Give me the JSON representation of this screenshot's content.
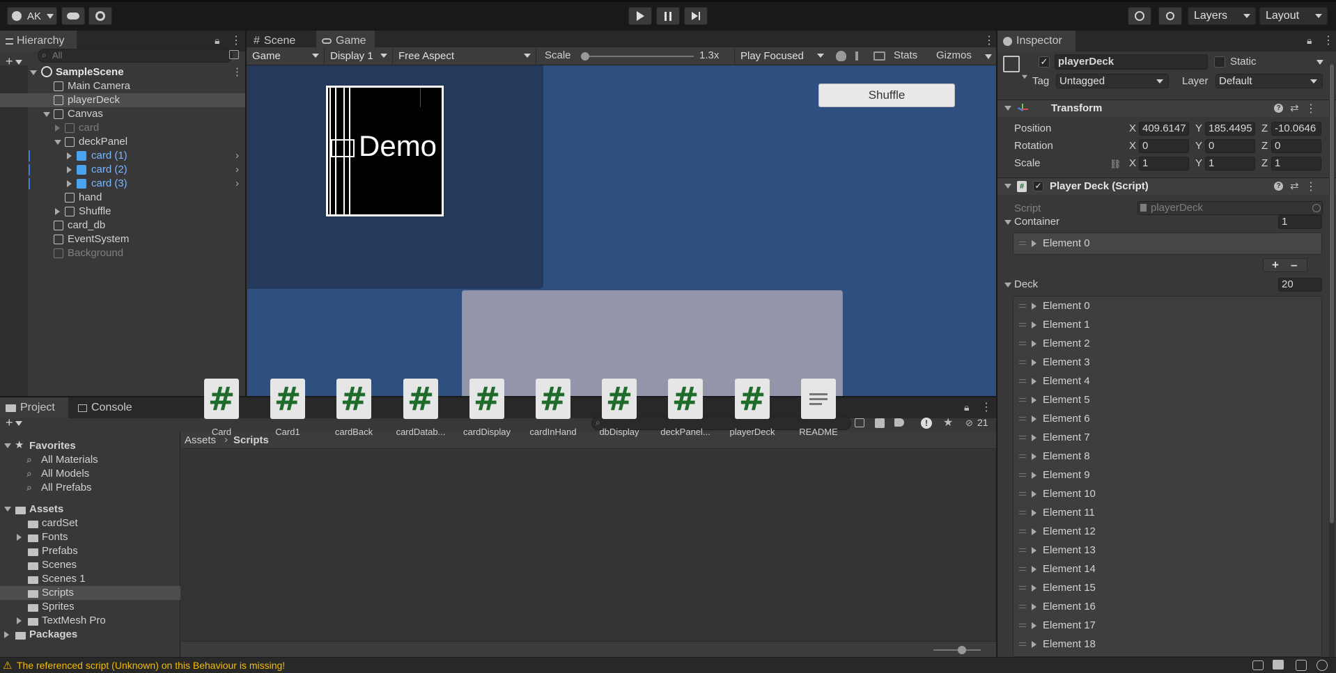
{
  "toolbar": {
    "account": "AK",
    "layers": "Layers",
    "layout": "Layout"
  },
  "hierarchy": {
    "tab": "Hierarchy",
    "search_placeholder": "All",
    "scene": "SampleScene",
    "items": [
      {
        "label": "Main Camera"
      },
      {
        "label": "playerDeck"
      },
      {
        "label": "Canvas"
      },
      {
        "label": "card"
      },
      {
        "label": "deckPanel"
      },
      {
        "label": "card (1)"
      },
      {
        "label": "card (2)"
      },
      {
        "label": "card (3)"
      },
      {
        "label": "hand"
      },
      {
        "label": "Shuffle"
      },
      {
        "label": "card_db"
      },
      {
        "label": "EventSystem"
      },
      {
        "label": "Background"
      }
    ]
  },
  "view": {
    "tab_scene": "Scene",
    "tab_game": "Game",
    "game_dropdown": "Game",
    "display": "Display 1",
    "aspect": "Free Aspect",
    "scale_label": "Scale",
    "scale_value": "1.3x",
    "scale_level": 0.0,
    "play_mode": "Play Focused",
    "stats": "Stats",
    "gizmos": "Gizmos",
    "card_text": "Demo",
    "shuffle_button": "Shuffle"
  },
  "inspector": {
    "tab": "Inspector",
    "object_name": "playerDeck",
    "static_label": "Static",
    "tag_label": "Tag",
    "tag_value": "Untagged",
    "layer_label": "Layer",
    "layer_value": "Default",
    "transform": {
      "title": "Transform",
      "position_label": "Position",
      "rotation_label": "Rotation",
      "scale_label": "Scale",
      "position": {
        "x": "409.6147",
        "y": "185.4495",
        "z": "-10.0646"
      },
      "rotation": {
        "x": "0",
        "y": "0",
        "z": "0"
      },
      "scale": {
        "x": "1",
        "y": "1",
        "z": "1"
      },
      "axis_x": "X",
      "axis_y": "Y",
      "axis_z": "Z"
    },
    "script_component": {
      "title": "Player Deck (Script)",
      "script_label": "Script",
      "script_value": "playerDeck",
      "container_label": "Container",
      "container_count": "1",
      "container_elements": [
        "Element 0"
      ],
      "deck_label": "Deck",
      "deck_count": "20",
      "deck_elements": [
        "Element 0",
        "Element 1",
        "Element 2",
        "Element 3",
        "Element 4",
        "Element 5",
        "Element 6",
        "Element 7",
        "Element 8",
        "Element 9",
        "Element 10",
        "Element 11",
        "Element 12",
        "Element 13",
        "Element 14",
        "Element 15",
        "Element 16",
        "Element 17",
        "Element 18"
      ]
    }
  },
  "project": {
    "tab_project": "Project",
    "tab_console": "Console",
    "hidden_count": "21",
    "favorites_label": "Favorites",
    "favorites": [
      "All Materials",
      "All Models",
      "All Prefabs"
    ],
    "assets_label": "Assets",
    "asset_folders": [
      "cardSet",
      "Fonts",
      "Prefabs",
      "Scenes",
      "Scenes 1",
      "Scripts",
      "Sprites",
      "TextMesh Pro"
    ],
    "packages_label": "Packages",
    "breadcrumb_root": "Assets",
    "breadcrumb_current": "Scripts",
    "files": [
      "Card",
      "Card1",
      "cardBack",
      "cardDatab...",
      "cardDisplay",
      "cardInHand",
      "dbDisplay",
      "deckPanel...",
      "playerDeck",
      "README"
    ]
  },
  "status": {
    "message": "The referenced script (Unknown) on this Behaviour is missing!"
  },
  "colors": {
    "game_bg": "#2e4f80",
    "panel_dark": "#24395c",
    "selection": "#4d4d4d",
    "prefab_blue": "#7cb7ff",
    "warning": "#f4bc02",
    "script_green": "#1f6b2b"
  }
}
